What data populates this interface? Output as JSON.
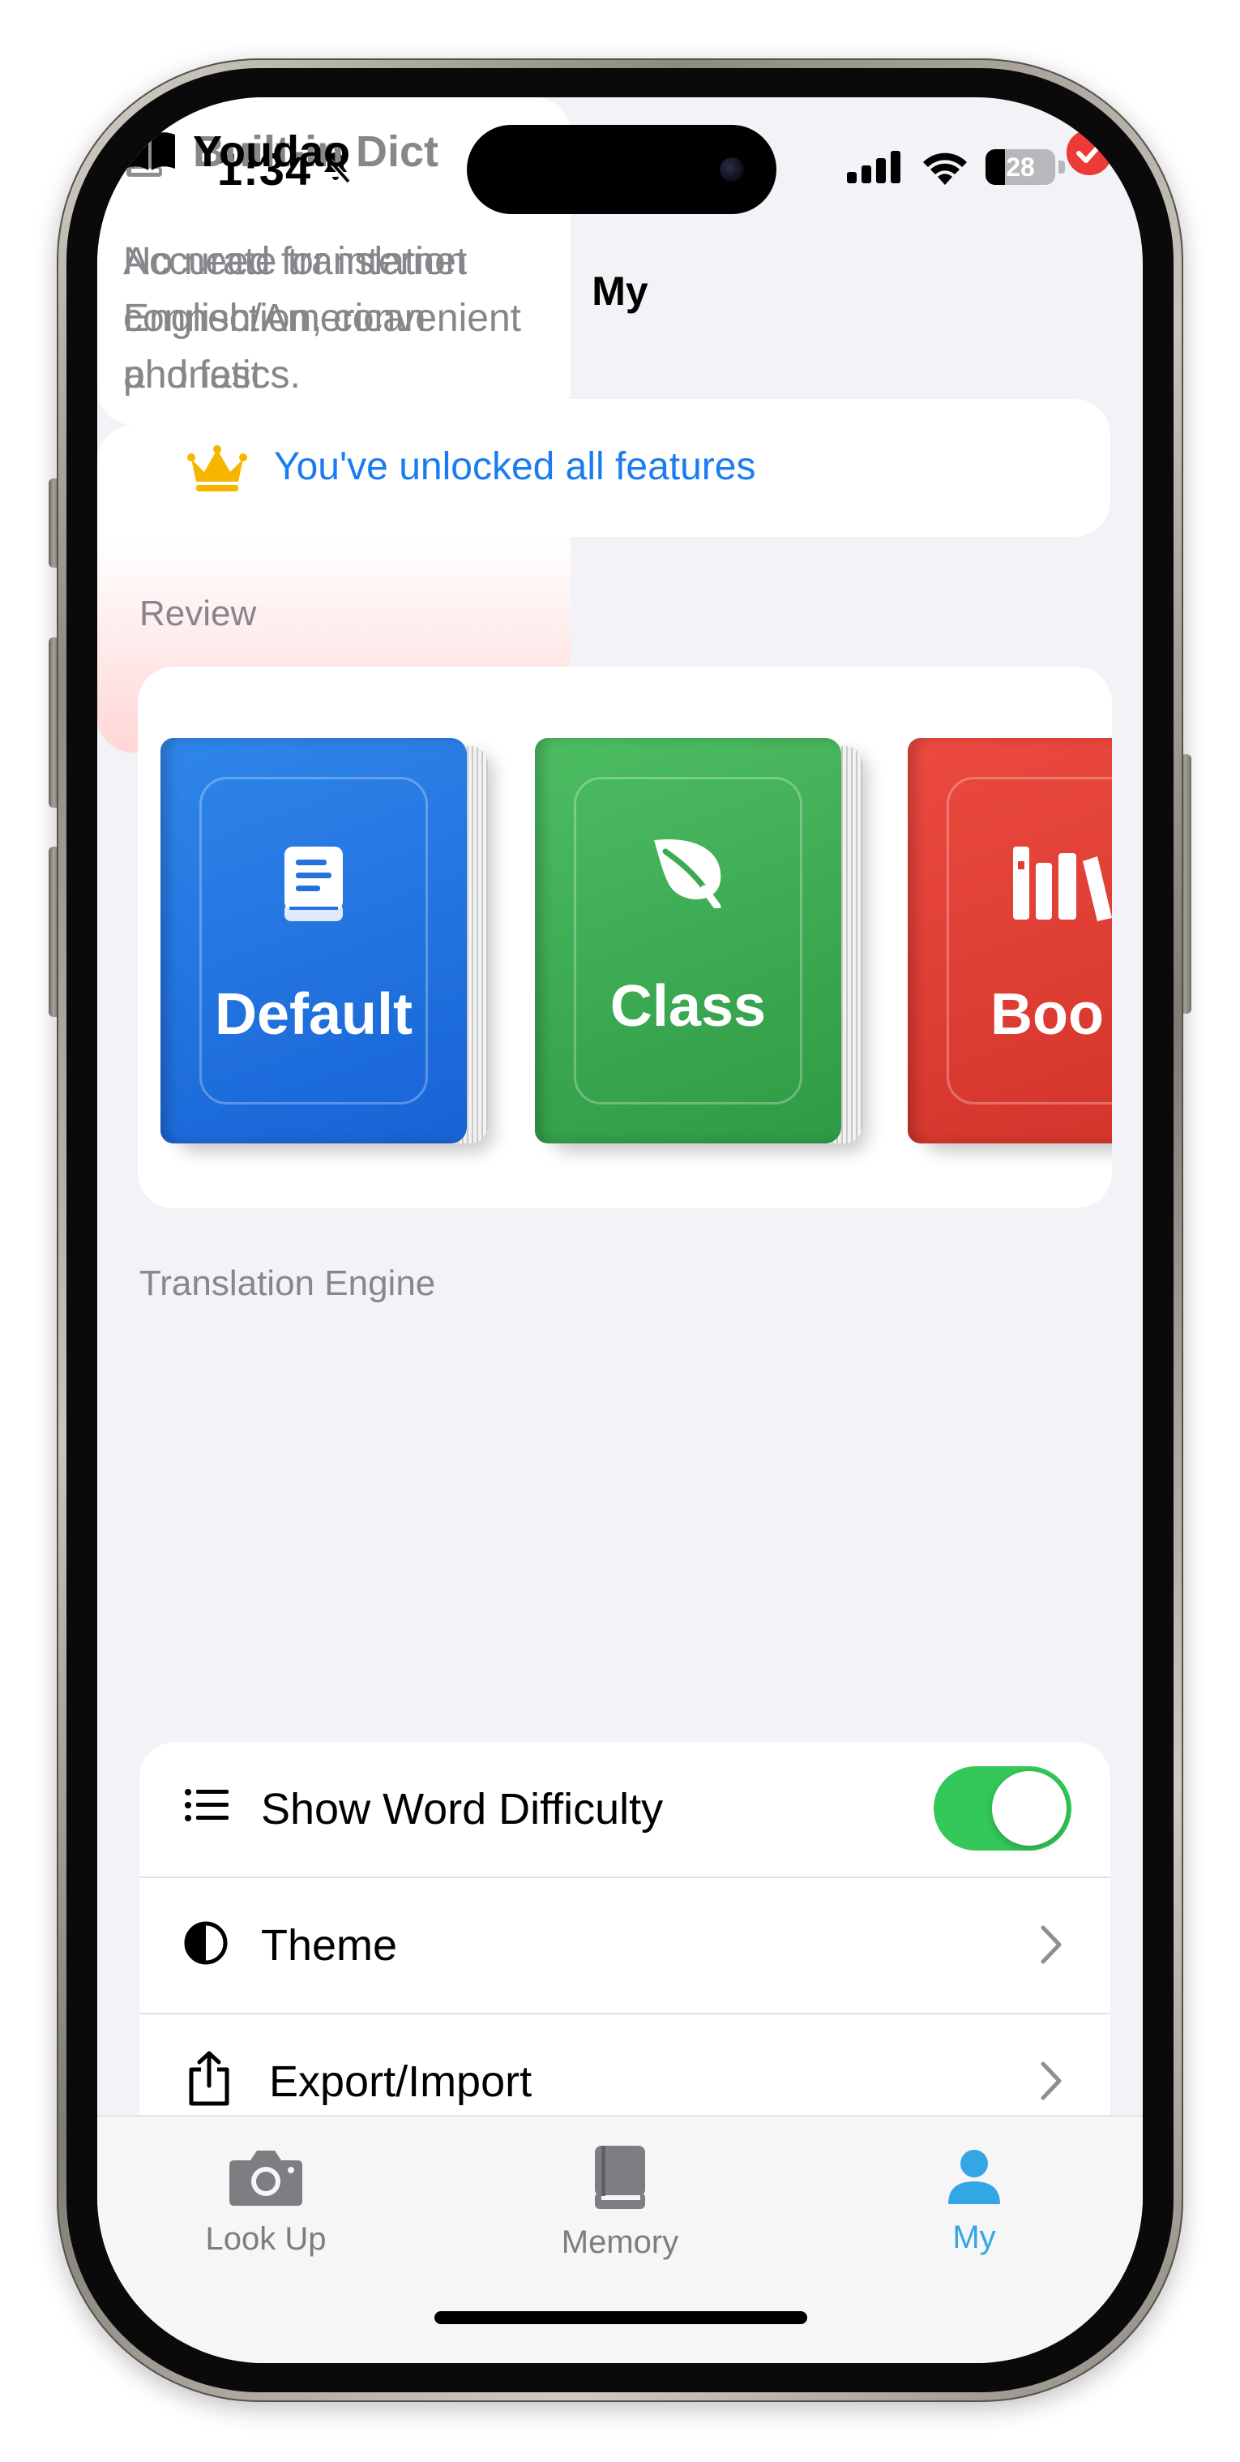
{
  "status_bar": {
    "time": "1:34",
    "battery": "28"
  },
  "header": {
    "title": "My"
  },
  "unlock_banner": {
    "text": "You've unlocked all features"
  },
  "review": {
    "section_label": "Review",
    "books": [
      {
        "label": "Default",
        "color": "#1f72e0",
        "icon": "book-icon"
      },
      {
        "label": "Class",
        "color": "#3aab52",
        "icon": "leaf-icon"
      },
      {
        "label": "Boo",
        "color": "#e03e35",
        "icon": "books-icon"
      }
    ]
  },
  "translation_engine": {
    "section_label": "Translation Engine",
    "options": [
      {
        "title": "Built-in Dict",
        "description": "No need for internet connection, convenient and fast",
        "selected": false
      },
      {
        "title": "Youdao",
        "description": "Accurate translation English/American phonetics.",
        "selected": true
      }
    ]
  },
  "settings": {
    "rows": [
      {
        "label": "Show Word Difficulty",
        "control": "toggle",
        "value": true,
        "icon": "list-icon"
      },
      {
        "label": "Theme",
        "control": "chevron",
        "icon": "contrast-icon"
      },
      {
        "label": "Export/Import",
        "control": "chevron",
        "icon": "share-icon"
      }
    ]
  },
  "tab_bar": {
    "tabs": [
      {
        "label": "Look Up",
        "icon": "camera-icon",
        "active": false
      },
      {
        "label": "Memory",
        "icon": "book-icon",
        "active": false
      },
      {
        "label": "My",
        "icon": "person-icon",
        "active": true
      }
    ]
  },
  "colors": {
    "accent_blue": "#1a7cf0",
    "toggle_green": "#34c759",
    "check_red": "#ee3a36",
    "tab_active": "#35a6e5"
  }
}
